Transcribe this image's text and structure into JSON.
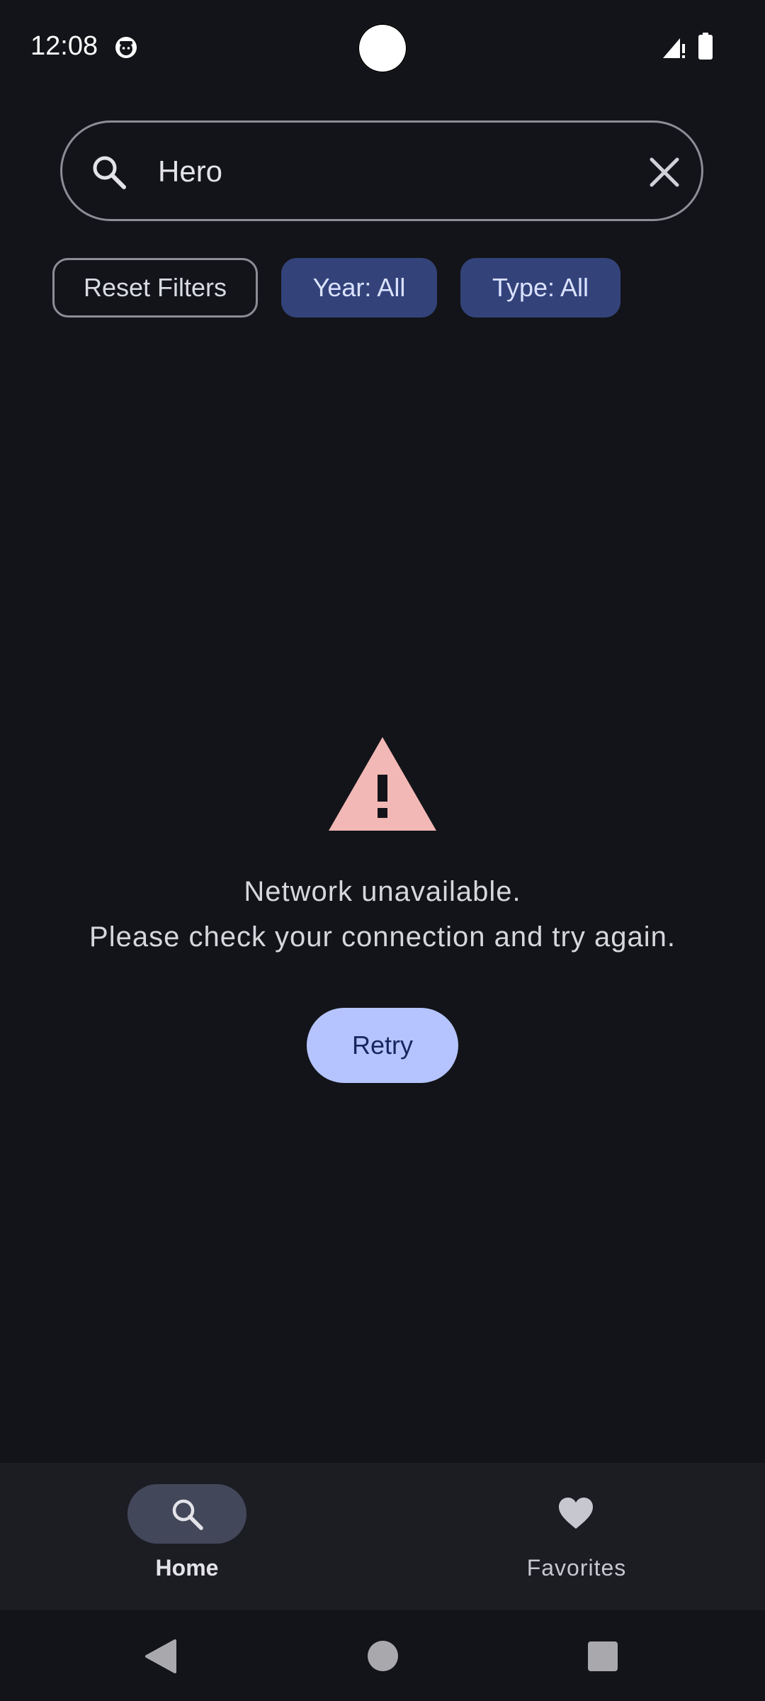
{
  "status_bar": {
    "time": "12:08",
    "icons": [
      "app-notification-icon",
      "signal-icon",
      "battery-icon"
    ]
  },
  "search": {
    "value": "Hero",
    "icon": "search-icon",
    "clear_icon": "close-icon"
  },
  "filters": {
    "reset_label": "Reset Filters",
    "year_label": "Year: All",
    "type_label": "Type: All"
  },
  "error": {
    "icon": "warning-icon",
    "line1": "Network unavailable.",
    "line2": "Please check your connection and try again.",
    "retry_label": "Retry"
  },
  "bottom_nav": {
    "items": [
      {
        "label": "Home",
        "icon": "search-icon",
        "selected": true
      },
      {
        "label": "Favorites",
        "icon": "heart-icon",
        "selected": false
      }
    ]
  },
  "system_nav": {
    "buttons": [
      "back-icon",
      "home-icon",
      "recents-icon"
    ]
  },
  "colors": {
    "background": "#131419",
    "chip_active": "#33437a",
    "retry_button": "#b5c4ff",
    "warning": "#f2b8b5",
    "nav_bar": "#1c1d23",
    "nav_pill": "#42475a"
  }
}
